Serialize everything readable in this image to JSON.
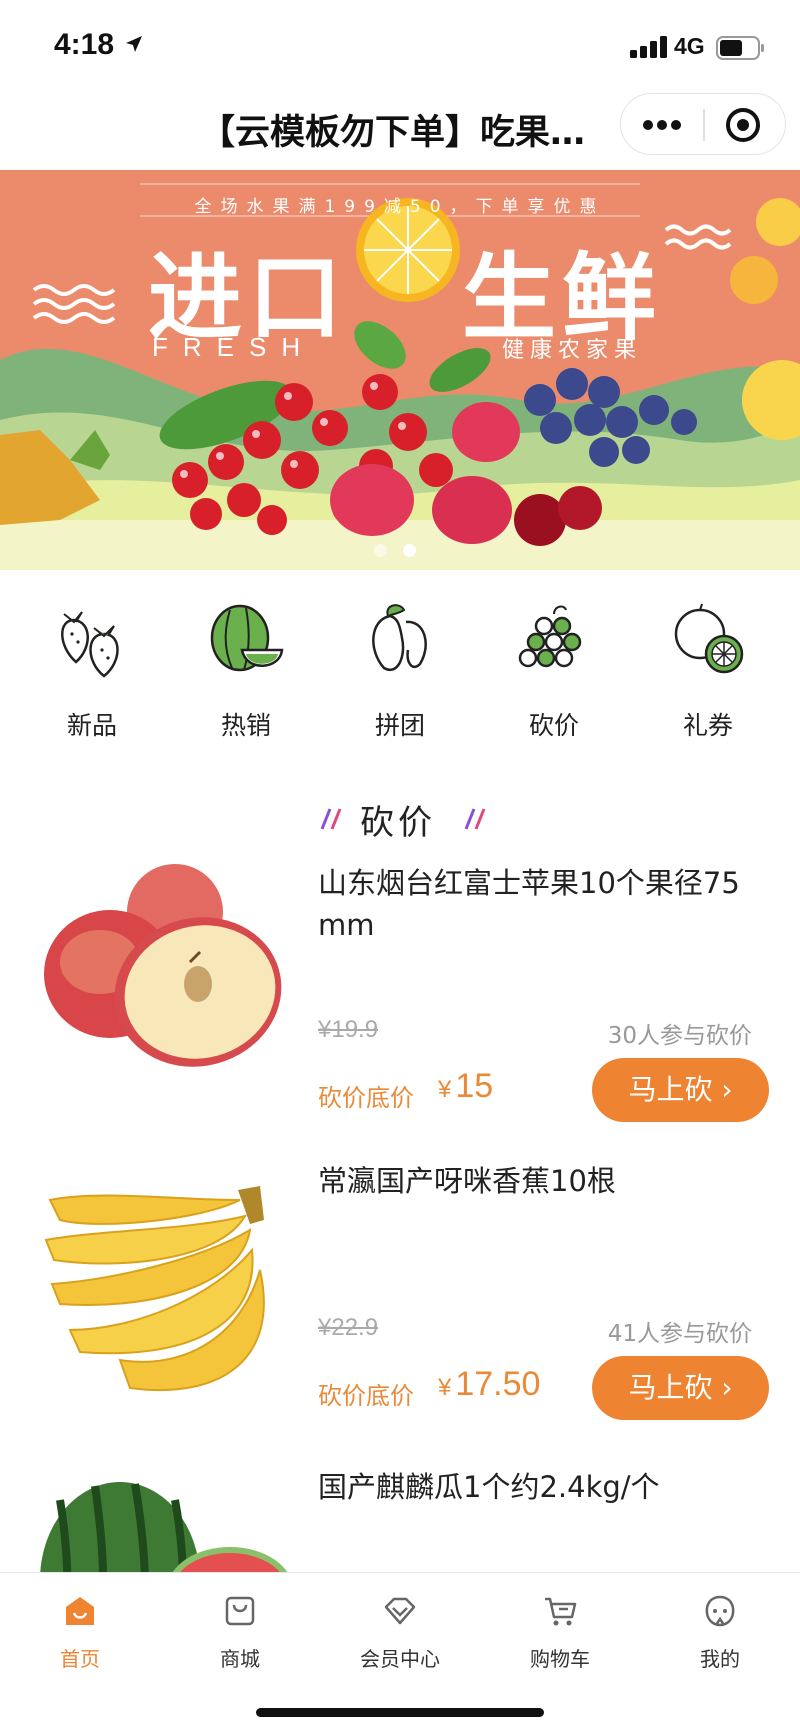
{
  "status_bar": {
    "time": "4:18",
    "network": "4G"
  },
  "nav": {
    "title": "【云模板勿下单】吃果…"
  },
  "banner": {
    "promo": "全场水果满199减50，下单享优惠",
    "title_left": "进口",
    "title_right": "生鲜",
    "subtitle_en": "FRESH",
    "subtitle_cn": "健康农家果",
    "slides": 2,
    "active_slide": 2
  },
  "categories": [
    {
      "label": "新品",
      "icon": "strawberry-icon"
    },
    {
      "label": "热销",
      "icon": "watermelon-icon"
    },
    {
      "label": "拼团",
      "icon": "mango-icon"
    },
    {
      "label": "砍价",
      "icon": "grapes-icon"
    },
    {
      "label": "礼券",
      "icon": "orange-lemon-icon"
    }
  ],
  "section": {
    "title": "砍价"
  },
  "products": [
    {
      "name": "山东烟台红富士苹果10个果径75mm",
      "original_price": "¥19.9",
      "joined": "30人参与砍价",
      "price_label": "砍价底价",
      "currency": "¥",
      "price": "15",
      "button": "马上砍 ›",
      "image": "apple-image"
    },
    {
      "name": "常瀛国产呀咪香蕉10根",
      "original_price": "¥22.9",
      "joined": "41人参与砍价",
      "price_label": "砍价底价",
      "currency": "¥",
      "price": "17.50",
      "button": "马上砍 ›",
      "image": "banana-image"
    },
    {
      "name": "国产麒麟瓜1个约2.4kg/个",
      "image": "watermelon-image"
    }
  ],
  "tabbar": [
    {
      "label": "首页",
      "icon": "home-icon",
      "active": true
    },
    {
      "label": "商城",
      "icon": "shopping-bag-icon",
      "active": false
    },
    {
      "label": "会员中心",
      "icon": "diamond-icon",
      "active": false
    },
    {
      "label": "购物车",
      "icon": "cart-icon",
      "active": false
    },
    {
      "label": "我的",
      "icon": "user-icon",
      "active": false
    }
  ],
  "colors": {
    "accent": "#ee8431",
    "banner_bg": "#ec8b6c",
    "price": "#e98a38"
  }
}
